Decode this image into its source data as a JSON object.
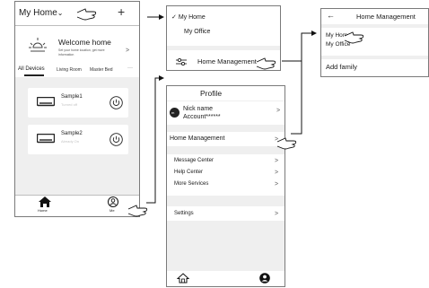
{
  "screen1": {
    "home_title": "My Home",
    "add_label": "+",
    "welcome_title": "Welcome home",
    "welcome_sub1": "Set your home location, get more",
    "welcome_sub2": "information",
    "tabs": [
      "All Devices",
      "Living Room",
      "Master Bed",
      "···"
    ],
    "devices": [
      {
        "name": "Sample1",
        "status": "Turned off"
      },
      {
        "name": "Sample2",
        "status": "Already On"
      }
    ],
    "nav_home": "Home",
    "nav_me": "Me"
  },
  "dropdown": {
    "items": [
      "My Home",
      "My Office"
    ],
    "checkmark": "✓",
    "manage_label": "Home Management"
  },
  "manage": {
    "back": "←",
    "title": "Home Management",
    "homes": [
      "My Home",
      "My Office"
    ],
    "add_family": "Add family"
  },
  "profile": {
    "title": "Profile",
    "nick_name": "Nick name",
    "account": "Account******",
    "menu": {
      "home_management": "Home Management",
      "message_center": "Message Center",
      "help_center": "Help Center",
      "more_services": "More Services",
      "settings": "Settings"
    },
    "chevron": ">"
  }
}
